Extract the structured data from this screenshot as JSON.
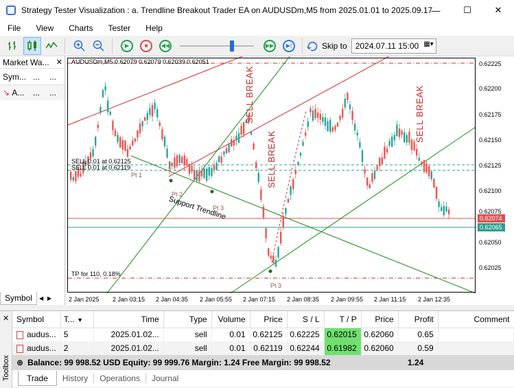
{
  "window": {
    "title": "Strategy Tester Visualization : a. Trendline Breakout Trader EA on AUDUSDm,M5 from 2025.01.01 to 2025.09.17",
    "minimize": "—",
    "maximize": "☐",
    "close": "✕"
  },
  "menu": [
    "File",
    "View",
    "Charts",
    "Tester",
    "Help"
  ],
  "toolbar": {
    "skip_label": "Skip to",
    "skip_date": "2024.07.11 15:00",
    "speed": 0.72
  },
  "market_watch": {
    "title": "Market Wa...",
    "close": "✕",
    "columns": [
      "Sym...",
      "...",
      "..."
    ],
    "row": {
      "symbol": "A...",
      "c2": "...",
      "c3": "..."
    },
    "tab": "Symbol"
  },
  "chart": {
    "header": "AUDUSDm,M5  0.62079 0.62079 0.62039 0.62051",
    "price_labels": [
      "0.62225",
      "0.62200",
      "0.62175",
      "0.62150",
      "0.62125",
      "0.62100",
      "0.62075",
      "0.62050",
      "0.62025"
    ],
    "price_flags": [
      {
        "value": "0.62074",
        "color": "#e05050"
      },
      {
        "value": "0.62065",
        "color": "#2aa090"
      }
    ],
    "time_labels": [
      "2 Jan 2025",
      "2 Jan 03:15",
      "2 Jan 04:35",
      "2 Jan 05:55",
      "2 Jan 07:15",
      "2 Jan 08:35",
      "2 Jan 09:55",
      "2 Jan 11:15",
      "2 Jan 12:35"
    ],
    "annotations": {
      "sell1": "SELL 0.01 at 0.62125",
      "sell2": "SELL 0.01 at 0.62119",
      "tp": "TP for 110, 0.18%",
      "pt1": "Pt 1",
      "pt2": "Pt 2",
      "pt3a": "Pt 3",
      "pt3b": "Pt 3",
      "trendline": "Support Trendline",
      "sell_break": "SELL BREAK"
    }
  },
  "toolbox": {
    "close": "✕",
    "side_label": "Toolbox",
    "columns": [
      "Symbol",
      "T...",
      "Time",
      "Type",
      "Volume",
      "Price",
      "S / L",
      "T / P",
      "Price",
      "Profit",
      "Comment"
    ],
    "rows": [
      {
        "symbol": "audus...",
        "ticket": "5",
        "time": "2025.01.02...",
        "type": "sell",
        "volume": "0.01",
        "price": "0.62125",
        "sl": "0.62225",
        "tp": "0.62015",
        "cur": "0.62060",
        "profit": "0.65",
        "comment": ""
      },
      {
        "symbol": "audus...",
        "ticket": "2",
        "time": "2025.01.02...",
        "type": "sell",
        "volume": "0.01",
        "price": "0.62119",
        "sl": "0.62244",
        "tp": "0.61982",
        "cur": "0.62060",
        "profit": "0.59",
        "comment": ""
      }
    ],
    "balance_line": "Balance: 99 998.52 USD  Equity: 99 999.76  Margin: 1.24  Free Margin: 99 998.52",
    "balance_total": "1.24",
    "tabs": [
      "Trade",
      "History",
      "Operations",
      "Journal"
    ]
  },
  "colors": {
    "bull": "#26a69a",
    "bear": "#ef5350",
    "red_line": "#d42a2a",
    "green_line": "#1a8a1a",
    "dark_green": "#2e7d32",
    "tp_highlight": "#6fe06f"
  }
}
